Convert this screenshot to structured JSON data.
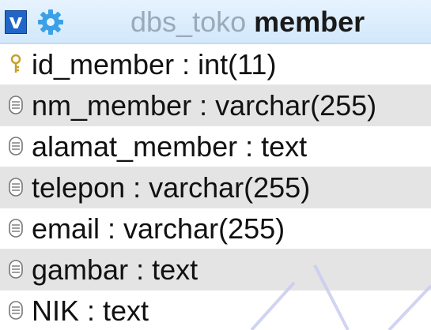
{
  "header": {
    "database": "dbs_toko",
    "table": "member",
    "toggle_label": "v",
    "toggle_icon": "collapse-icon",
    "options_icon": "gear-icon"
  },
  "columns": [
    {
      "label": "id_member : int(11)",
      "icon": "primary-key-icon"
    },
    {
      "label": "nm_member : varchar(255)",
      "icon": "column-icon"
    },
    {
      "label": "alamat_member : text",
      "icon": "column-icon"
    },
    {
      "label": "telepon : varchar(255)",
      "icon": "column-icon"
    },
    {
      "label": "email : varchar(255)",
      "icon": "column-icon"
    },
    {
      "label": "gambar : text",
      "icon": "column-icon"
    },
    {
      "label": "NIK : text",
      "icon": "column-icon"
    }
  ],
  "colors": {
    "header_bg": "#d2e8fb",
    "toggle_bg": "#1f66c8",
    "row_alt_bg": "#e4e4e4",
    "key_icon": "#c8a02a"
  }
}
